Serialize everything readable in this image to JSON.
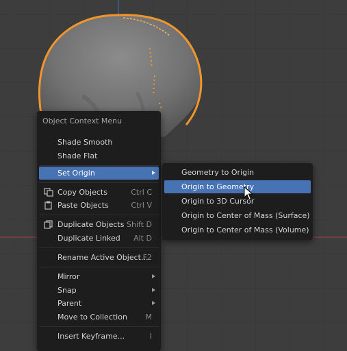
{
  "colors": {
    "viewport_bg": "#3d3d3d",
    "grid_line": "#363636",
    "x_axis": "#8a3d4a",
    "y_axis": "#3a5f9a",
    "selection_outline": "#f2962b",
    "menu_bg": "#1d1d1d",
    "highlight": "#4772b3"
  },
  "context_menu": {
    "title": "Object Context Menu",
    "items": [
      {
        "label": "Shade Smooth",
        "shortcut": ""
      },
      {
        "label": "Shade Flat",
        "shortcut": ""
      },
      {
        "label": "Set Origin",
        "shortcut": "",
        "submenu": true
      },
      {
        "label": "Copy Objects",
        "shortcut": "Ctrl C",
        "icon": "copy-icon"
      },
      {
        "label": "Paste Objects",
        "shortcut": "Ctrl V",
        "icon": "paste-icon"
      },
      {
        "label": "Duplicate Objects",
        "shortcut": "Shift D",
        "icon": "duplicate-icon"
      },
      {
        "label": "Duplicate Linked",
        "shortcut": "Alt D"
      },
      {
        "label": "Rename Active Object...",
        "shortcut": "F2"
      },
      {
        "label": "Mirror",
        "shortcut": "",
        "submenu": true
      },
      {
        "label": "Snap",
        "shortcut": "",
        "submenu": true
      },
      {
        "label": "Parent",
        "shortcut": "",
        "submenu": true
      },
      {
        "label": "Move to Collection",
        "shortcut": "M"
      },
      {
        "label": "Insert Keyframe...",
        "shortcut": "I"
      }
    ]
  },
  "set_origin_submenu": {
    "items": [
      {
        "label": "Geometry to Origin"
      },
      {
        "label": "Origin to Geometry"
      },
      {
        "label": "Origin to 3D Cursor"
      },
      {
        "label": "Origin to Center of Mass (Surface)"
      },
      {
        "label": "Origin to Center of Mass (Volume)"
      }
    ]
  }
}
